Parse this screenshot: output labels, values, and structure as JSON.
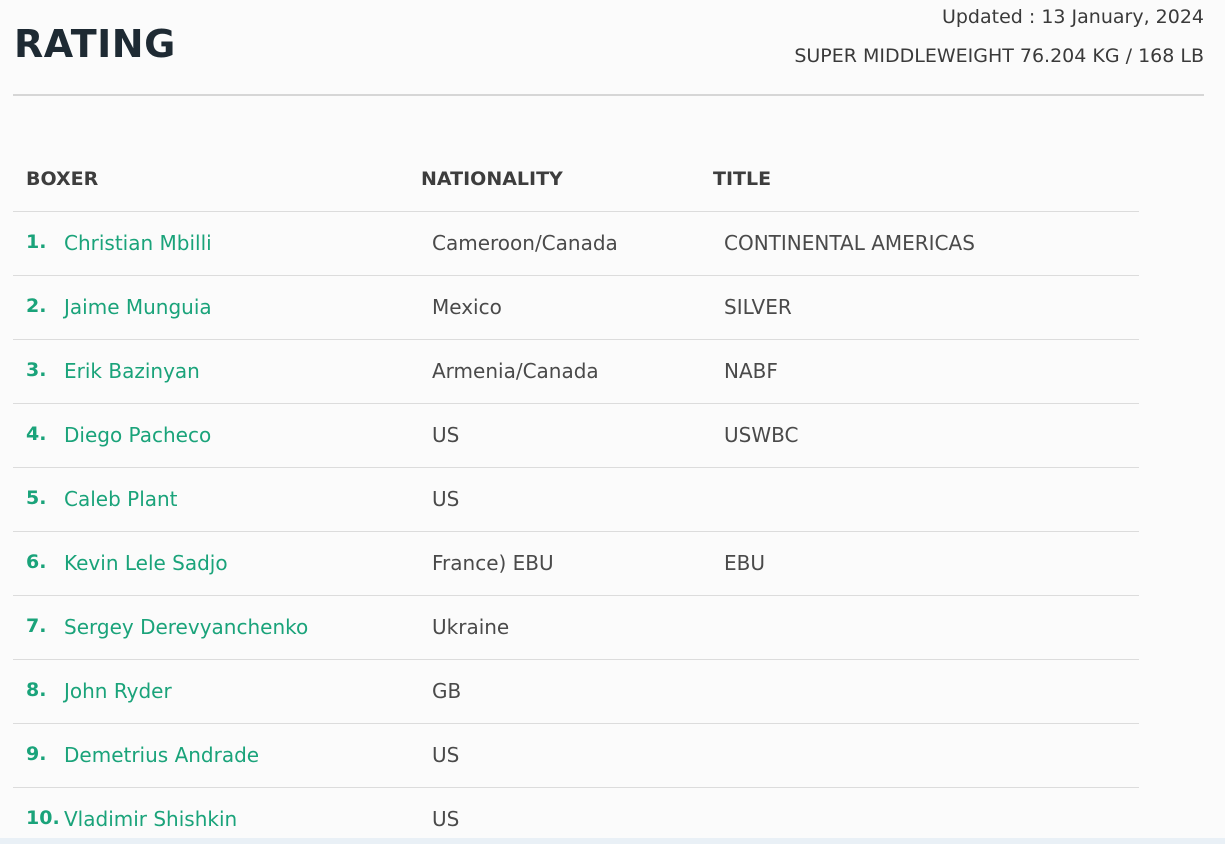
{
  "header": {
    "title": "RATING",
    "updated": "Updated : 13 January, 2024",
    "category": "SUPER MIDDLEWEIGHT 76.204 KG / 168 LB"
  },
  "table": {
    "columns": [
      "BOXER",
      "NATIONALITY",
      "TITLE"
    ],
    "rows": [
      {
        "rank": "1.",
        "boxer": "Christian Mbilli",
        "nationality": "Cameroon/Canada",
        "title": "CONTINENTAL AMERICAS"
      },
      {
        "rank": "2.",
        "boxer": "Jaime Munguia",
        "nationality": "Mexico",
        "title": "SILVER"
      },
      {
        "rank": "3.",
        "boxer": "Erik Bazinyan",
        "nationality": "Armenia/Canada",
        "title": "NABF"
      },
      {
        "rank": "4.",
        "boxer": "Diego Pacheco",
        "nationality": "US",
        "title": "USWBC"
      },
      {
        "rank": "5.",
        "boxer": "Caleb Plant",
        "nationality": "US",
        "title": ""
      },
      {
        "rank": "6.",
        "boxer": "Kevin Lele Sadjo",
        "nationality": "France) EBU",
        "title": "EBU"
      },
      {
        "rank": "7.",
        "boxer": "Sergey Derevyanchenko",
        "nationality": "Ukraine",
        "title": ""
      },
      {
        "rank": "8.",
        "boxer": "John Ryder",
        "nationality": "GB",
        "title": ""
      },
      {
        "rank": "9.",
        "boxer": "Demetrius Andrade",
        "nationality": "US",
        "title": ""
      },
      {
        "rank": "10.",
        "boxer": "Vladimir Shishkin",
        "nationality": "US",
        "title": ""
      }
    ]
  },
  "colors": {
    "accent": "#1aa37a",
    "title": "#1e2a33",
    "text": "#4a4a4a"
  }
}
